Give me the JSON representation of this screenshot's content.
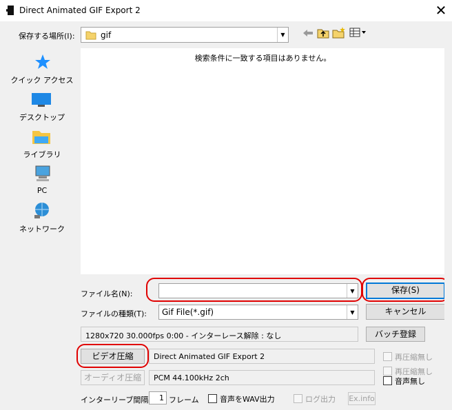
{
  "window": {
    "title": "Direct Animated GIF Export 2",
    "close_glyph": "✕"
  },
  "location": {
    "label": "保存する場所(I):",
    "value": "gif"
  },
  "toolbar_icons": [
    "back-arrow-icon",
    "up-folder-icon",
    "new-folder-icon",
    "view-menu-icon"
  ],
  "places": [
    {
      "label": "クイック アクセス",
      "icon": "star-icon"
    },
    {
      "label": "デスクトップ",
      "icon": "desktop-icon"
    },
    {
      "label": "ライブラリ",
      "icon": "library-icon"
    },
    {
      "label": "PC",
      "icon": "pc-icon"
    },
    {
      "label": "ネットワーク",
      "icon": "network-icon"
    }
  ],
  "file_list": {
    "empty_message": "検索条件に一致する項目はありません。"
  },
  "filename": {
    "label": "ファイル名(N):",
    "value": ""
  },
  "filetype": {
    "label": "ファイルの種類(T):",
    "value": "Gif File(*.gif)"
  },
  "buttons": {
    "save": "保存(S)",
    "cancel": "キャンセル",
    "batch": "バッチ登録",
    "video_compress": "ビデオ圧縮",
    "audio_compress": "オーディオ圧縮",
    "exinfo": "Ex.info"
  },
  "info": {
    "video_stats": "1280x720  30.000fps  0:00  -  インターレース解除 : なし",
    "video_codec": "Direct Animated GIF Export 2",
    "audio_codec": "PCM 44.100kHz 2ch"
  },
  "checkboxes": {
    "recompress_video": "再圧縮無し",
    "recompress_audio": "再圧縮無し",
    "no_audio": "音声無し",
    "wav_output": "音声をWAV出力",
    "log_output": "ログ出力"
  },
  "interleave": {
    "label": "インターリーブ間隔 :",
    "value": "1",
    "unit": "フレーム"
  }
}
